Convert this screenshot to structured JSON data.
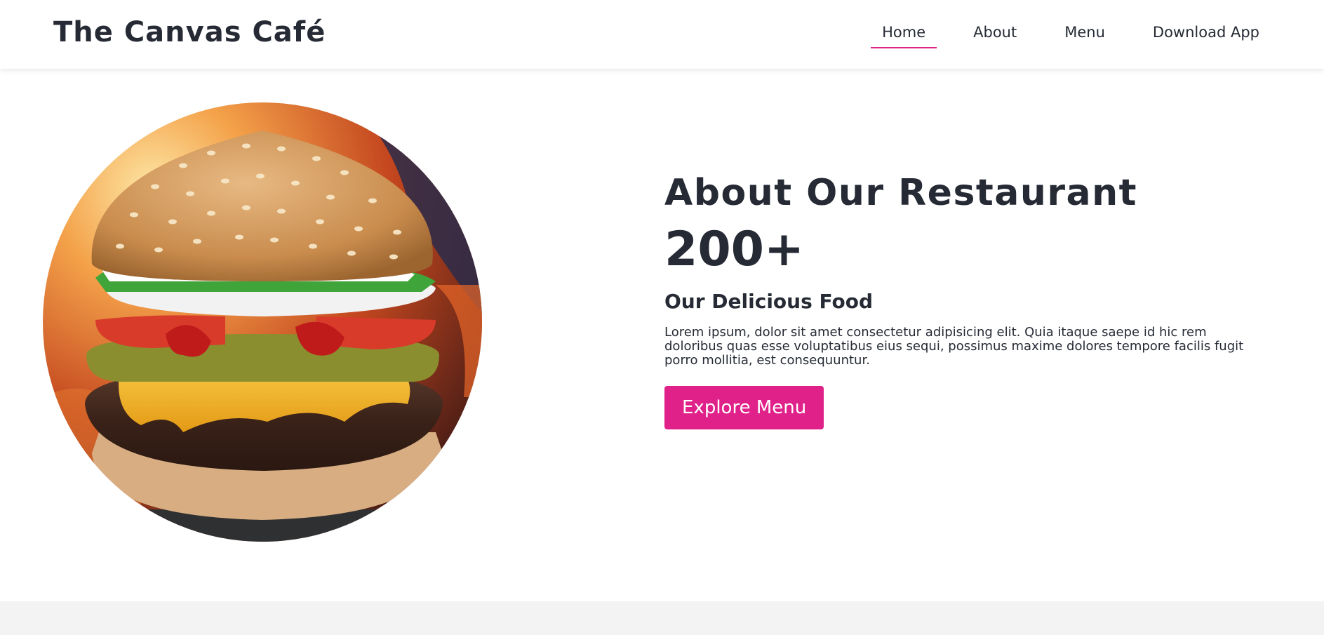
{
  "navbar": {
    "brand": "The Canvas Café",
    "links": [
      {
        "label": "Home",
        "active": true
      },
      {
        "label": "About",
        "active": false
      },
      {
        "label": "Menu",
        "active": false
      },
      {
        "label": "Download App",
        "active": false
      }
    ]
  },
  "hero": {
    "image_subject": "burger-photo"
  },
  "about": {
    "title": "About Our Restaurant",
    "stat": "200+",
    "subtitle": "Our Delicious Food",
    "description": "Lorem ipsum, dolor sit amet consectetur adipisicing elit. Quia itaque saepe id hic rem doloribus quas esse voluptatibus eius sequi, possimus maxime dolores tempore facilis fugit porro mollitia, est consequuntur.",
    "button_label": "Explore Menu"
  },
  "colors": {
    "accent": "#e0218a",
    "text": "#252a34",
    "footer_band": "#f3f3f3"
  }
}
